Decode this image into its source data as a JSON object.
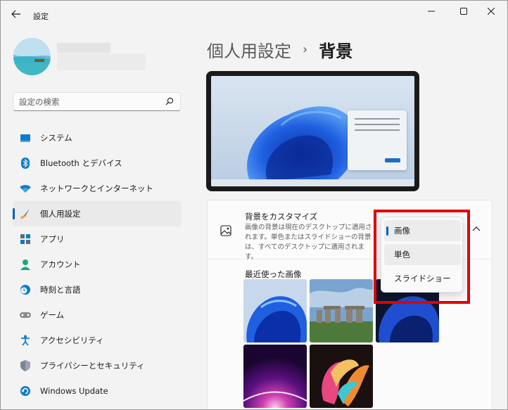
{
  "window": {
    "title": "設定"
  },
  "search": {
    "placeholder": "設定の検索"
  },
  "sidebar": {
    "items": [
      {
        "label": "システム",
        "icon": "monitor-icon"
      },
      {
        "label": "Bluetooth とデバイス",
        "icon": "bluetooth-icon"
      },
      {
        "label": "ネットワークとインターネット",
        "icon": "wifi-icon"
      },
      {
        "label": "個人用設定",
        "icon": "brush-icon",
        "active": true
      },
      {
        "label": "アプリ",
        "icon": "apps-icon"
      },
      {
        "label": "アカウント",
        "icon": "person-icon"
      },
      {
        "label": "時刻と言語",
        "icon": "clock-globe-icon"
      },
      {
        "label": "ゲーム",
        "icon": "gamepad-icon"
      },
      {
        "label": "アクセシビリティ",
        "icon": "accessibility-icon"
      },
      {
        "label": "プライバシーとセキュリティ",
        "icon": "shield-icon"
      },
      {
        "label": "Windows Update",
        "icon": "update-icon"
      }
    ]
  },
  "breadcrumb": {
    "parent": "個人用設定",
    "separator": "›",
    "current": "背景"
  },
  "background_card": {
    "title": "背景をカスタマイズ",
    "description": "画像の背景は現在のデスクトップに適用されます。単色またはスライドショーの背景は、すべてのデスクトップに適用されます。"
  },
  "recent": {
    "label": "最近使った画像"
  },
  "dropdown": {
    "options": [
      "画像",
      "単色",
      "スライドショー"
    ],
    "selected": "画像"
  },
  "colors": {
    "accent": "#005fb8",
    "highlight": "#e20000"
  }
}
